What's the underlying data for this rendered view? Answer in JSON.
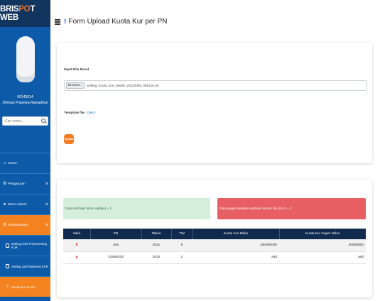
{
  "sidebar": {
    "logo": {
      "part1": "BRIS",
      "part2": "P",
      "part3": "T WEB",
      "accent_glyph": "O"
    },
    "user": {
      "id": "00143014",
      "name": "Dhimas Prasetya Ramadhan"
    },
    "search": {
      "placeholder": "Cari menu..."
    },
    "menu": [
      {
        "label": "Home",
        "icon": "home-icon"
      },
      {
        "label": "Pengaturan",
        "icon": "gear-icon"
      },
      {
        "label": "Menu Admin",
        "icon": "user-icon"
      },
      {
        "label": "Administrator",
        "icon": "admin-gear-icon"
      }
    ],
    "submenu": [
      {
        "label": "Setting Limit Prescreening KUR",
        "icon": "doc-icon"
      },
      {
        "label": "Setting Limit Nasional KUR",
        "icon": "doc-icon"
      },
      {
        "label": "Kuota Kur per PN",
        "icon": "upload-icon"
      }
    ]
  },
  "header": {
    "title": "Form Upload Kuota Kur per PN"
  },
  "form": {
    "file_label": "Input File Excel",
    "browse_label": "Browse...",
    "file_name": "Setting_Kuota_Kur_Mantri_20220308_091416.xls",
    "template_label": "Template file",
    "template_link": "Disini",
    "upload_label": "Upload"
  },
  "results": {
    "success_msg": "Data berhasil lolos validasi = 1",
    "error_msg": "Data gagal validasi arahkan kursor di icon X = 2",
    "columns": [
      "Valid",
      "PN",
      "Tahun",
      "TW",
      "Kuota Kur Mikro",
      "Kuota Kur Super Mikro"
    ],
    "rows": [
      {
        "valid": "x",
        "pn": "345",
        "tahun": "2021",
        "tw": "5",
        "mikro": "100000000",
        "super_mikro": "30000000"
      },
      {
        "valid": "x",
        "pn": "23456323",
        "tahun": "2022",
        "tw": "1",
        "mikro": "asd",
        "super_mikro": "asd"
      }
    ]
  },
  "colors": {
    "sidebar": "#0d5ba8",
    "sidebar_dark": "#12355f",
    "accent": "#f3821f",
    "table_header": "#0f2a4d",
    "error": "#e75f62",
    "success": "#d5eedc"
  }
}
